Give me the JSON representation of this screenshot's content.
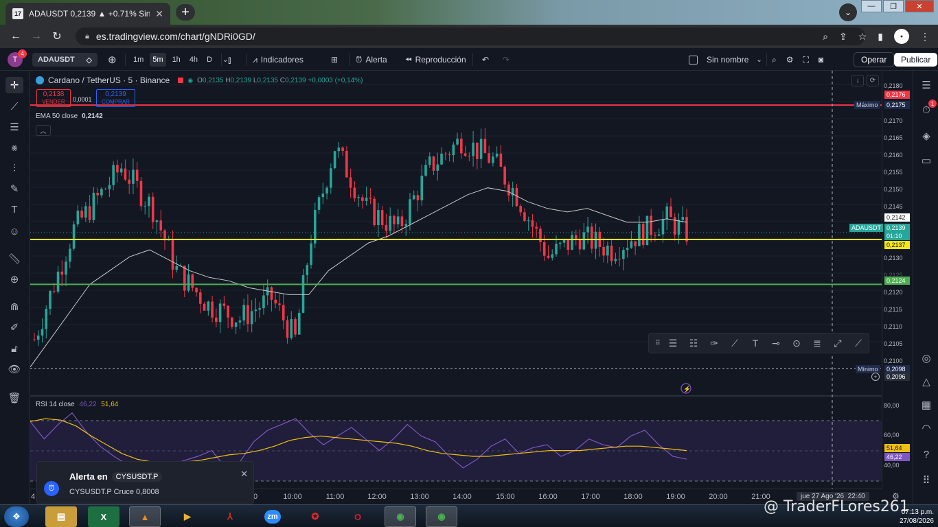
{
  "browser": {
    "tab_title": "ADAUSDT 0,2139 ▲ +0.71% Sin nombre",
    "favicon_text": "17",
    "url": "es.tradingview.com/chart/gNDRi0GD/"
  },
  "toolbar": {
    "avatar_initial": "T",
    "avatar_badge": "4",
    "symbol": "ADAUSDT",
    "intervals": [
      "1m",
      "5m",
      "1h",
      "4h",
      "D"
    ],
    "selected_interval": "5m",
    "indicators_label": "Indicadores",
    "alert_label": "Alerta",
    "replay_label": "Reproducción",
    "layout_name": "Sin nombre",
    "trade_label": "Operar",
    "publish_label": "Publicar"
  },
  "legend": {
    "title": "Cardano / TetherUS · 5 · Binance",
    "o_label": "O",
    "o": "0,2135",
    "h_label": "H",
    "h": "0,2139",
    "l_label": "L",
    "l": "0,2135",
    "c_label": "C",
    "c": "0,2139",
    "change": "+0,0003 (+0,14%)",
    "sell_price": "0,2138",
    "sell_label": "VENDER",
    "spread": "0,0001",
    "buy_price": "0,2139",
    "buy_label": "COMPRAR",
    "ema_label": "EMA 50 close",
    "ema_value": "0,2142",
    "rsi_label": "RSI 14 close",
    "rsi_value": "46,22",
    "rsi_ma_value": "51,64"
  },
  "price_axis": {
    "ticks": [
      "0,2180",
      "0,2170",
      "0,2165",
      "0,2160",
      "0,2155",
      "0,2150",
      "0,2145",
      "0,2130",
      "0,2125",
      "0,2120",
      "0,2115",
      "0,2110",
      "0,2105",
      "0,2100"
    ],
    "max_label": "Máximo",
    "max_value": "0,2175",
    "red_line_value": "0,2176",
    "min_label": "Mínimo",
    "min_value": "0,2098",
    "crosshair_value": "0,2096",
    "ema_tag": "0,2142",
    "symbol_tag": "ADAUSDT",
    "last_price": "0,2139",
    "countdown": "01:10",
    "yellow_line_value": "0,2137",
    "green_line_value": "0,2124",
    "rsi_ticks": [
      "80,00",
      "60,00",
      "40,00"
    ],
    "rsi_ma_tag": "51,64",
    "rsi_tag": "46,22"
  },
  "time_axis": {
    "ticks": [
      "10:00",
      "11:00",
      "12:00",
      "13:00",
      "14:00",
      "15:00",
      "16:00",
      "17:00",
      "18:00",
      "19:00",
      "20:00",
      "21:00"
    ],
    "left_partial_1": "4",
    "left_partial_2": "0",
    "crosshair_date": "jue 27 Ago '26",
    "crosshair_time": "22:40"
  },
  "alert_popup": {
    "title": "Alerta en",
    "symbol": "CYSUSDT.P",
    "message": "CYSUSDT.P Cruce 0,8008"
  },
  "taskbar": {
    "watermark": "@ TraderFLores261",
    "date": "27/08/2026",
    "time_partial": "07:13 p.m."
  },
  "colors": {
    "bull": "#26a69a",
    "bear": "#f23645",
    "ema": "#c9c9c9",
    "red_line": "#f23645",
    "yellow_line": "#f5e617",
    "green_line": "#4caf50",
    "rsi": "#7e57c2",
    "rsi_ma": "#f0c010"
  },
  "chart_data": {
    "type": "candlestick",
    "symbol": "ADAUSDT",
    "interval": "5",
    "price_range": [
      0.2096,
      0.2182
    ],
    "horizontal_lines": [
      0.2176,
      0.2137,
      0.2124
    ],
    "ema50_last": 0.2142,
    "rsi_range": [
      30,
      84
    ],
    "rsi_levels": [
      70,
      50,
      30
    ],
    "series": [
      {
        "name": "EMA 50 close",
        "values": [
          0.21,
          0.2108,
          0.2116,
          0.2124,
          0.2128,
          0.2132,
          0.2134,
          0.2131,
          0.2128,
          0.2126,
          0.2125,
          0.2123,
          0.2122,
          0.2121,
          0.2121,
          0.2128,
          0.2132,
          0.2136,
          0.2138,
          0.2141,
          0.2144,
          0.2147,
          0.215,
          0.2152,
          0.2151,
          0.2148,
          0.2146,
          0.2145,
          0.2146,
          0.2144,
          0.2142,
          0.2142,
          0.2143,
          0.2142
        ]
      },
      {
        "name": "RSI 14 close",
        "values": [
          72,
          60,
          70,
          78,
          65,
          55,
          48,
          42,
          36,
          40,
          42,
          45,
          48,
          52,
          40,
          44,
          58,
          66,
          70,
          74,
          64,
          56,
          62,
          68,
          60,
          52,
          60,
          70,
          62,
          58,
          48,
          40,
          46,
          55,
          60,
          50,
          54,
          56,
          48,
          52,
          60,
          56,
          54,
          62,
          66,
          56,
          48,
          46
        ]
      },
      {
        "name": "RSI MA",
        "values": [
          72,
          74,
          73,
          69,
          62,
          56,
          50,
          46,
          44,
          43,
          44,
          45,
          47,
          49,
          50,
          52,
          55,
          59,
          61,
          62,
          61,
          60,
          59,
          58,
          57,
          55,
          52,
          50,
          49,
          48,
          48,
          49,
          50,
          51,
          52,
          52,
          52,
          53,
          54,
          55,
          55,
          54,
          53,
          52
        ]
      }
    ]
  }
}
